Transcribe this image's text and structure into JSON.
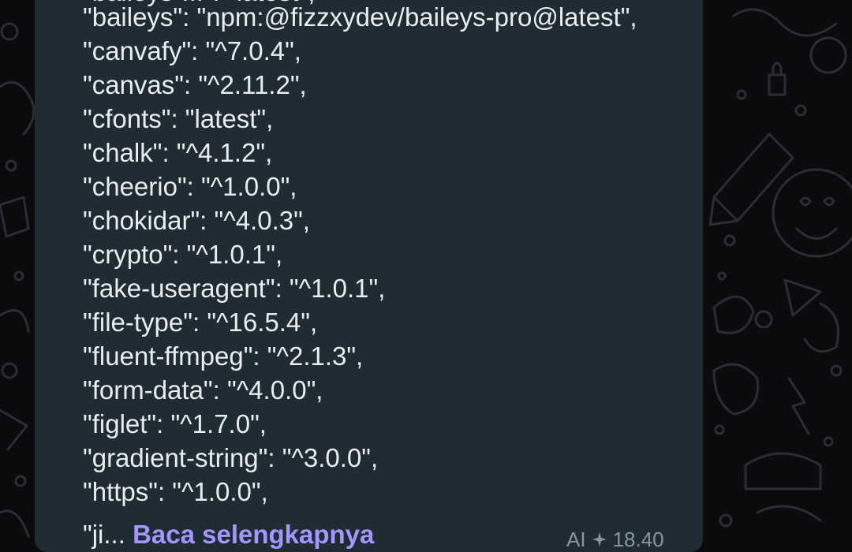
{
  "message": {
    "top_partial_line": "\"baileys-...\": \"latest\",",
    "lines": [
      "\"baileys\": \"npm:@fizzxydev/baileys-pro@latest\",",
      "\"canvafy\": \"^7.0.4\",",
      "\"canvas\": \"^2.11.2\",",
      "\"cfonts\": \"latest\",",
      "\"chalk\": \"^4.1.2\",",
      "\"cheerio\": \"^1.0.0\",",
      "\"chokidar\": \"^4.0.3\",",
      "\"crypto\": \"^1.0.1\",",
      "\"fake-useragent\": \"^1.0.1\",",
      "\"file-type\": \"^16.5.4\",",
      "\"fluent-ffmpeg\": \"^2.1.3\",",
      "\"form-data\": \"^4.0.0\",",
      "\"figlet\": \"^1.7.0\",",
      "\"gradient-string\": \"^3.0.0\",",
      "\"https\": \"^1.0.0\","
    ],
    "truncated_text": "\"ji...",
    "read_more_label": "Baca selengkapnya",
    "ai_label": "AI",
    "time": "18.40"
  },
  "colors": {
    "bubble": "#1f2c34",
    "text": "#e9edef",
    "read_more": "#a496ff",
    "meta": "#8696a0",
    "wallpaper": "#0b0b0e",
    "doodle": "#2a2a33"
  },
  "icons": {
    "wallpaper": "whatsapp-doodle-pattern",
    "ai": "ai-sparkle-icon"
  }
}
